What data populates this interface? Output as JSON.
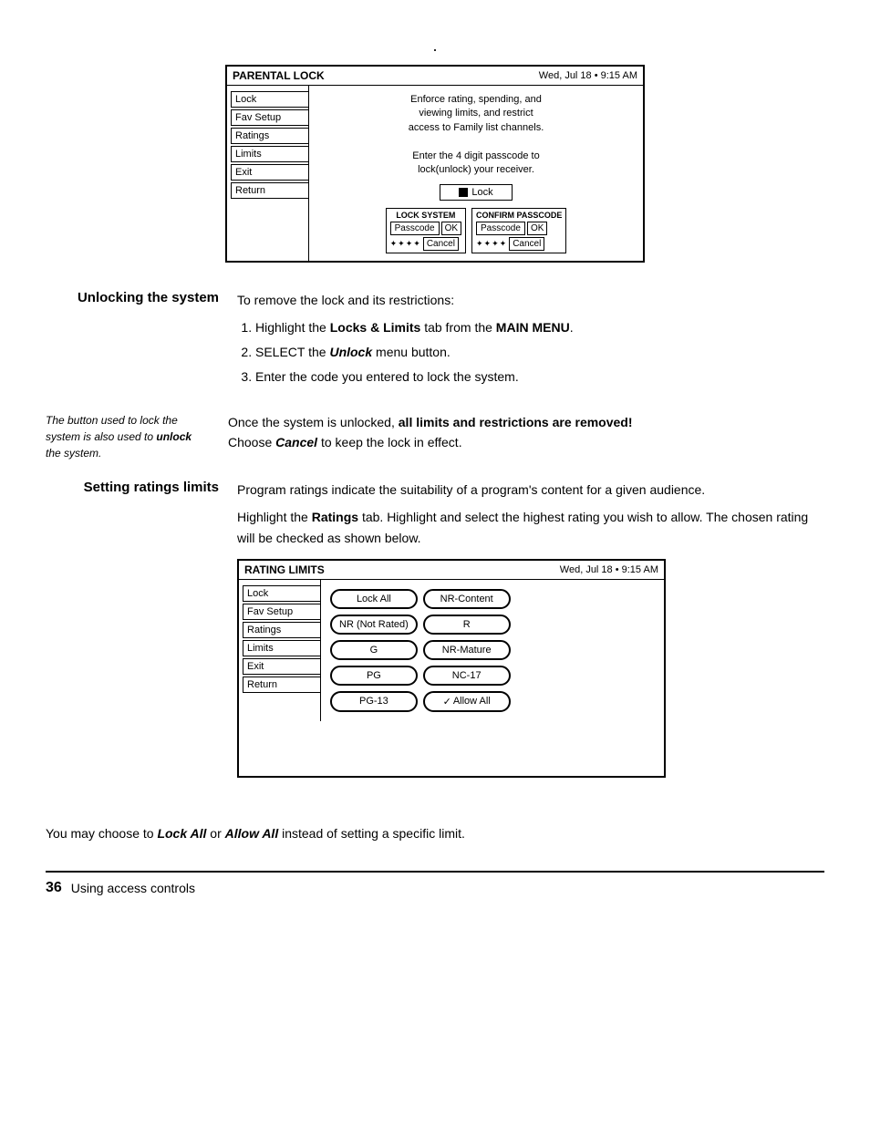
{
  "page": {
    "top_dot": ".",
    "parental_lock": {
      "title": "PARENTAL LOCK",
      "datetime": "Wed, Jul 18  •  9:15 AM",
      "menu_items": [
        "Lock",
        "Fav Setup",
        "Ratings",
        "Limits",
        "Exit",
        "Return"
      ],
      "description_line1": "Enforce rating, spending, and",
      "description_line2": "viewing limits, and restrict",
      "description_line3": "access to Family list channels.",
      "description_line4": "Enter the 4 digit passcode to",
      "description_line5": "lock(unlock) your receiver.",
      "lock_button_label": "Lock",
      "lock_system_title": "LOCK SYSTEM",
      "confirm_passcode_title": "CONFIRM PASSCODE",
      "passcode_label": "Passcode",
      "ok_label": "OK",
      "cancel_label": "Cancel"
    },
    "unlocking": {
      "title": "Unlocking the system",
      "intro": "To remove the lock and its restrictions:",
      "steps": [
        "Highlight the Locks & Limits tab from the MAIN MENU.",
        "SELECT the Unlock menu button.",
        "Enter the code you entered to lock the system."
      ],
      "note_italic": "The button used to lock the system is also used to unlock the system.",
      "note_bold_part1": "Once the system is unlocked, ",
      "note_bold_part2": "all limits and restrictions are removed!",
      "note_plain": "Choose Cancel to keep the lock in effect."
    },
    "rating_limits": {
      "title": "Setting ratings limits",
      "intro": "Program ratings indicate the suitability of a program's content for a given audience.",
      "instruction": "Highlight the Ratings tab. Highlight and select the highest rating you wish to allow. The chosen rating will be checked as shown below.",
      "screen": {
        "title": "RATING LIMITS",
        "datetime": "Wed, Jul 18  •  9:15 AM",
        "menu_items": [
          "Lock",
          "Fav Setup",
          "Ratings",
          "Limits",
          "Exit",
          "Return"
        ],
        "buttons": [
          {
            "label": "Lock All",
            "checked": false
          },
          {
            "label": "NR-Content",
            "checked": false
          },
          {
            "label": "NR (Not Rated)",
            "checked": false
          },
          {
            "label": "R",
            "checked": false
          },
          {
            "label": "G",
            "checked": false
          },
          {
            "label": "NR-Mature",
            "checked": false
          },
          {
            "label": "PG",
            "checked": false
          },
          {
            "label": "NC-17",
            "checked": false
          },
          {
            "label": "PG-13",
            "checked": false
          },
          {
            "label": "Allow All",
            "checked": true
          }
        ]
      },
      "bottom_note": "You may choose to Lock All or Allow All instead of setting a specific limit."
    },
    "footer": {
      "page_number": "36",
      "text": "Using access controls"
    }
  }
}
